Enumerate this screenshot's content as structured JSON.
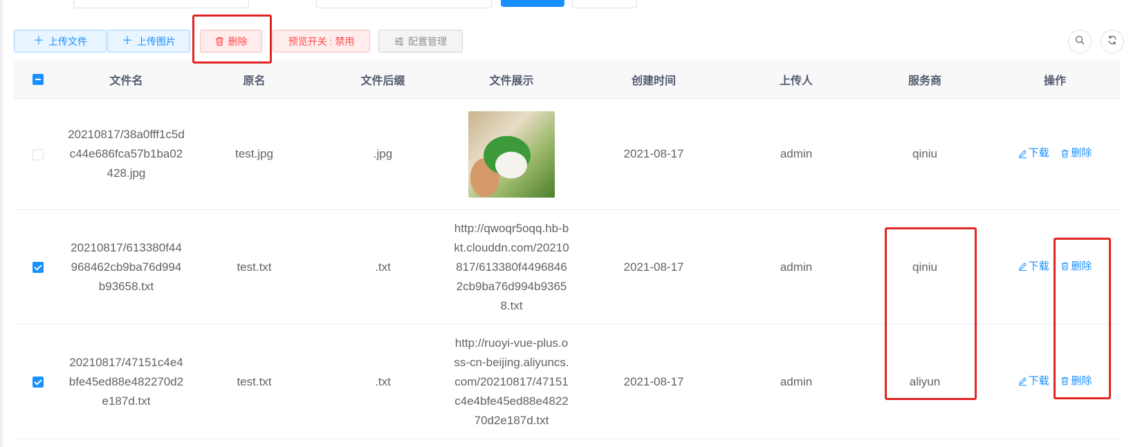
{
  "toolbar": {
    "upload_file": "上传文件",
    "upload_image": "上传图片",
    "delete": "删除",
    "preview_toggle": "预览开关 : 禁用",
    "config_manage": "配置管理"
  },
  "table": {
    "columns": [
      "文件名",
      "原名",
      "文件后缀",
      "文件展示",
      "创建时间",
      "上传人",
      "服务商",
      "操作"
    ],
    "rows": [
      {
        "checked": false,
        "file_name": "20210817/38a0fff1c5dc44e686fca57b1ba02428.jpg",
        "original_name": "test.jpg",
        "suffix": ".jpg",
        "display": "",
        "created": "2021-08-17",
        "uploader": "admin",
        "provider": "qiniu"
      },
      {
        "checked": true,
        "file_name": "20210817/613380f44968462cb9ba76d994b93658.txt",
        "original_name": "test.txt",
        "suffix": ".txt",
        "display": "http://qwoqr5oqq.hb-bkt.clouddn.com/20210817/613380f44968462cb9ba76d994b93658.txt",
        "created": "2021-08-17",
        "uploader": "admin",
        "provider": "qiniu"
      },
      {
        "checked": true,
        "file_name": "20210817/47151c4e4bfe45ed88e482270d2e187d.txt",
        "original_name": "test.txt",
        "suffix": ".txt",
        "display": "http://ruoyi-vue-plus.oss-cn-beijing.aliyuncs.com/20210817/47151c4e4bfe45ed88e482270d2e187d.txt",
        "created": "2021-08-17",
        "uploader": "admin",
        "provider": "aliyun"
      }
    ],
    "actions": {
      "download": "下载",
      "delete": "删除"
    }
  },
  "colors": {
    "primary": "#1890ff",
    "danger": "#ff4949",
    "highlight": "#e02424"
  },
  "icons": [
    "plus-icon",
    "trash-icon",
    "sliders-icon",
    "search-icon",
    "refresh-icon",
    "edit-icon"
  ]
}
